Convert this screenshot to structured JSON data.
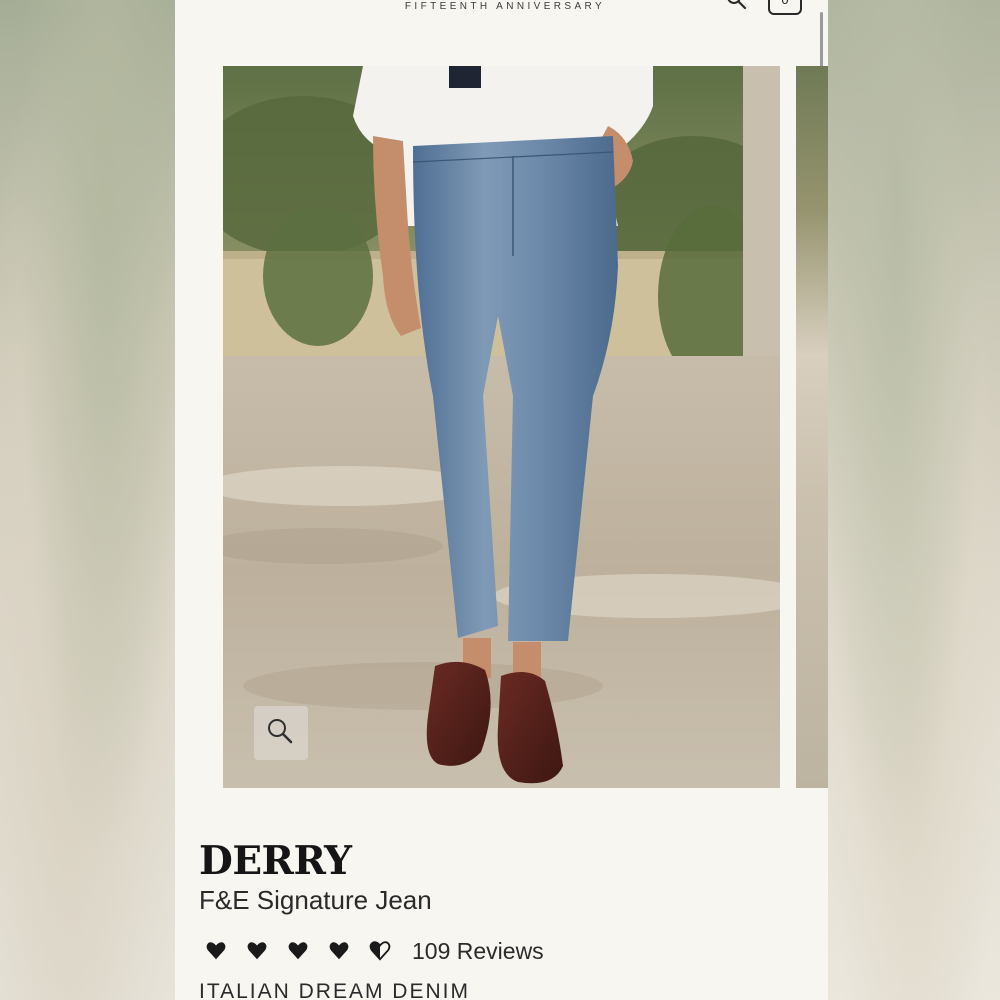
{
  "header": {
    "tagline": "FIFTEENTH ANNIVERSARY",
    "cart_count": "0",
    "icons": [
      "menu-icon",
      "search-icon",
      "cart-icon"
    ]
  },
  "gallery": {
    "zoom_icon": "magnifier-icon"
  },
  "product": {
    "name": "DERRY",
    "subtitle": "F&E Signature Jean",
    "rating": 4.5,
    "rating_max": 5,
    "rating_icon": "heart-icon",
    "reviews_label": "109 Reviews",
    "collection": "ITALIAN DREAM DENIM"
  },
  "colors": {
    "page_bg": "#f8f6f1",
    "text": "#151515",
    "heart": "#1a1a1a"
  }
}
